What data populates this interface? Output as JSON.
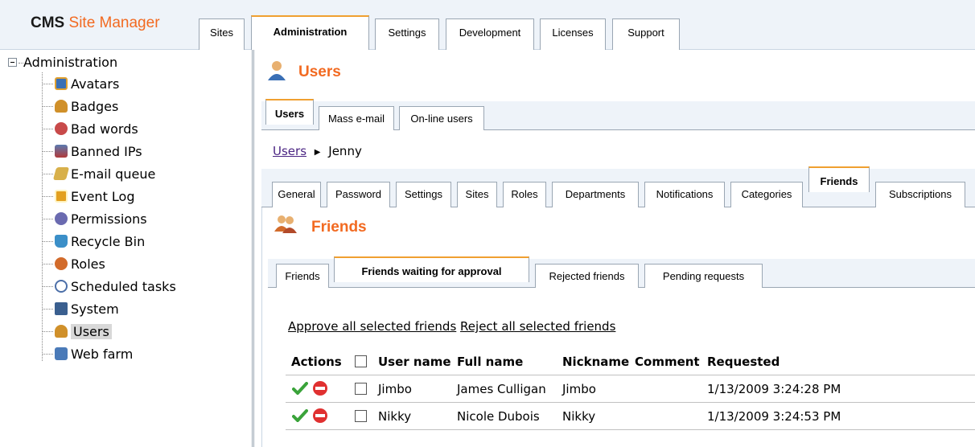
{
  "app": {
    "logo_cms": "CMS",
    "logo_rest": "Site Manager",
    "top_tabs": [
      "Sites",
      "Administration",
      "Settings",
      "Development",
      "Licenses",
      "Support"
    ],
    "active_top_tab": "Administration"
  },
  "tree": {
    "root_label": "Administration",
    "items": [
      {
        "label": "Avatars",
        "icon": "avatar-icon",
        "color": "#3a6fb5"
      },
      {
        "label": "Badges",
        "icon": "badge-icon",
        "color": "#d0902a"
      },
      {
        "label": "Bad words",
        "icon": "bad-words-icon",
        "color": "#c84a4a"
      },
      {
        "label": "Banned IPs",
        "icon": "banned-ip-icon",
        "color": "#b23a3a"
      },
      {
        "label": "E-mail queue",
        "icon": "email-queue-icon",
        "color": "#d8b04a"
      },
      {
        "label": "Event Log",
        "icon": "event-log-icon",
        "color": "#e3a020"
      },
      {
        "label": "Permissions",
        "icon": "permissions-icon",
        "color": "#6a6ab0"
      },
      {
        "label": "Recycle Bin",
        "icon": "recycle-bin-icon",
        "color": "#3b8fc8"
      },
      {
        "label": "Roles",
        "icon": "roles-icon",
        "color": "#d26b2b"
      },
      {
        "label": "Scheduled tasks",
        "icon": "scheduled-tasks-icon",
        "color": "#4c6fa8"
      },
      {
        "label": "System",
        "icon": "system-icon",
        "color": "#3a5f8f"
      },
      {
        "label": "Users",
        "icon": "users-icon",
        "color": "#d0902a"
      },
      {
        "label": "Web farm",
        "icon": "web-farm-icon",
        "color": "#4a7ab8"
      }
    ],
    "selected": "Users"
  },
  "users_section": {
    "title": "Users",
    "tabs": [
      "Users",
      "Mass e-mail",
      "On-line users"
    ],
    "active_tab": "Users"
  },
  "breadcrumb": {
    "link": "Users",
    "current": "Jenny"
  },
  "user_tabs": {
    "items": [
      "General",
      "Password",
      "Settings",
      "Sites",
      "Roles",
      "Departments",
      "Notifications",
      "Categories",
      "Friends",
      "Subscriptions"
    ],
    "active": "Friends"
  },
  "friends_section": {
    "title": "Friends",
    "tabs": [
      "Friends",
      "Friends waiting for approval",
      "Rejected friends",
      "Pending requests"
    ],
    "active_tab": "Friends waiting for approval"
  },
  "actions": {
    "approve_all": "Approve all selected friends",
    "reject_all": "Reject all selected friends"
  },
  "grid": {
    "columns": [
      "Actions",
      "User name",
      "Full name",
      "Nickname",
      "Comment",
      "Requested"
    ],
    "rows": [
      {
        "user_name": "Jimbo",
        "full_name": "James Culligan",
        "nickname": "Jimbo",
        "comment": "",
        "requested": "1/13/2009 3:24:28 PM"
      },
      {
        "user_name": "Nikky",
        "full_name": "Nicole Dubois",
        "nickname": "Nikky",
        "comment": "",
        "requested": "1/13/2009 3:24:53 PM"
      }
    ]
  },
  "colors": {
    "accent_orange": "#f26a21",
    "active_tab_border": "#f0a030",
    "approve_green": "#3aa33a",
    "reject_red": "#e03030"
  }
}
